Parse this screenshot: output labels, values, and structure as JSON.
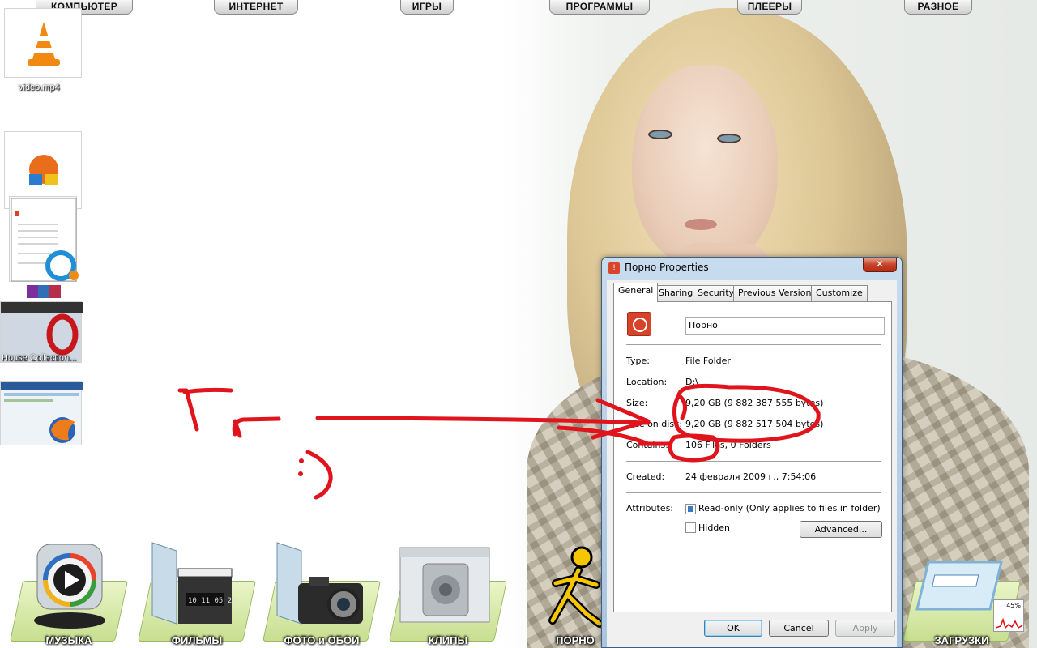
{
  "top_menu": [
    "КОМПЬЮТЕР",
    "ИНТЕРНЕТ",
    "ИГРЫ",
    "ПРОГРАММЫ",
    "ПЛЕЕРЫ",
    "РАЗНОЕ"
  ],
  "desktop_icons": {
    "video_label": "video.mp4",
    "house_label": "House Collection..."
  },
  "dock": [
    "МУЗЫКА",
    "ФИЛЬМЫ",
    "ФОТО и ОБОИ",
    "КЛИПЫ",
    "ПОРНО",
    "ЗАГРУЗКИ"
  ],
  "dialog": {
    "title": "Порно Properties",
    "close": "✕",
    "tabs": [
      "General",
      "Sharing",
      "Security",
      "Previous Versions",
      "Customize"
    ],
    "active_tab": "General",
    "folder_name": "Порно",
    "fields": {
      "type_label": "Type:",
      "type_value": "File Folder",
      "location_label": "Location:",
      "location_value": "D:\\",
      "size_label": "Size:",
      "size_value": "9,20 GB (9 882 387 555 bytes)",
      "size_on_disk_label": "Size on disk:",
      "size_on_disk_value": "9,20 GB (9 882 517 504 bytes)",
      "contains_label": "Contains:",
      "contains_value": "106 Files, 0 Folders",
      "created_label": "Created:",
      "created_value": "24 февраля 2009 г., 7:54:06",
      "attributes_label": "Attributes:"
    },
    "attributes": {
      "readonly_label": "Read-only (Only applies to files in folder)",
      "readonly_checked": true,
      "hidden_label": "Hidden",
      "hidden_checked": false,
      "advanced_button": "Advanced..."
    },
    "buttons": {
      "ok": "OK",
      "cancel": "Cancel",
      "apply": "Apply"
    }
  },
  "tray": {
    "cpu_percent": "45%"
  },
  "colors": {
    "annotation_red": "#e0141c",
    "dock_folder_green": "#c7df8f",
    "dialog_frame": "#a9c4df"
  }
}
